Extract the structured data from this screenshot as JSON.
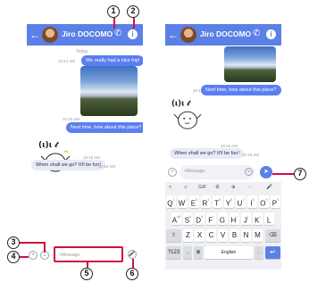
{
  "screens": [
    {
      "title": "Jiro DOCOMO",
      "day": "Today",
      "messages": [
        {
          "text": "We really had a nice trip!",
          "time": "10:14 AM"
        },
        {
          "text": "Next time, how about this place?",
          "time": "10:15 AM"
        },
        {
          "text": "When shall we go? It'll be fun!",
          "time": "10:16 AM"
        }
      ],
      "sticker_time": "10:16 AM",
      "composer_placeholder": "+Message"
    },
    {
      "title": "Jiro DOCOMO",
      "messages": [
        {
          "text": "Next time, how about this place?",
          "time": "10:15 AM"
        },
        {
          "text": "When shall we go? It'll be fun!",
          "time": "10:16 AM"
        }
      ],
      "sticker_time": "10:16 AM",
      "composer_placeholder": "+Message"
    }
  ],
  "keyboard": {
    "toolbar": [
      "<",
      "☺",
      "GIF",
      "⚙",
      "⊕",
      "···",
      "🎤"
    ],
    "row1": [
      "Q",
      "W",
      "E",
      "R",
      "T",
      "Y",
      "U",
      "I",
      "O",
      "P"
    ],
    "row1_hints": [
      "1",
      "2",
      "3",
      "4",
      "5",
      "6",
      "7",
      "8",
      "9",
      "0"
    ],
    "row2": [
      "A",
      "S",
      "D",
      "F",
      "G",
      "H",
      "J",
      "K",
      "L"
    ],
    "row2_hints": [
      "@",
      "#",
      "&",
      "*",
      "-",
      "+",
      "(",
      ")",
      "'"
    ],
    "row3": [
      "Z",
      "X",
      "C",
      "V",
      "B",
      "N",
      "M"
    ],
    "shift": "⇧",
    "backspace": "⌫",
    "symbols": "?123",
    "comma": ",",
    "globe": "⊕",
    "space_label": "English",
    "period": ".",
    "enter": "↵"
  },
  "callouts": [
    "1",
    "2",
    "3",
    "4",
    "5",
    "6",
    "7"
  ],
  "colors": {
    "accent": "#5b80e6",
    "callout_line": "#d0113d"
  }
}
